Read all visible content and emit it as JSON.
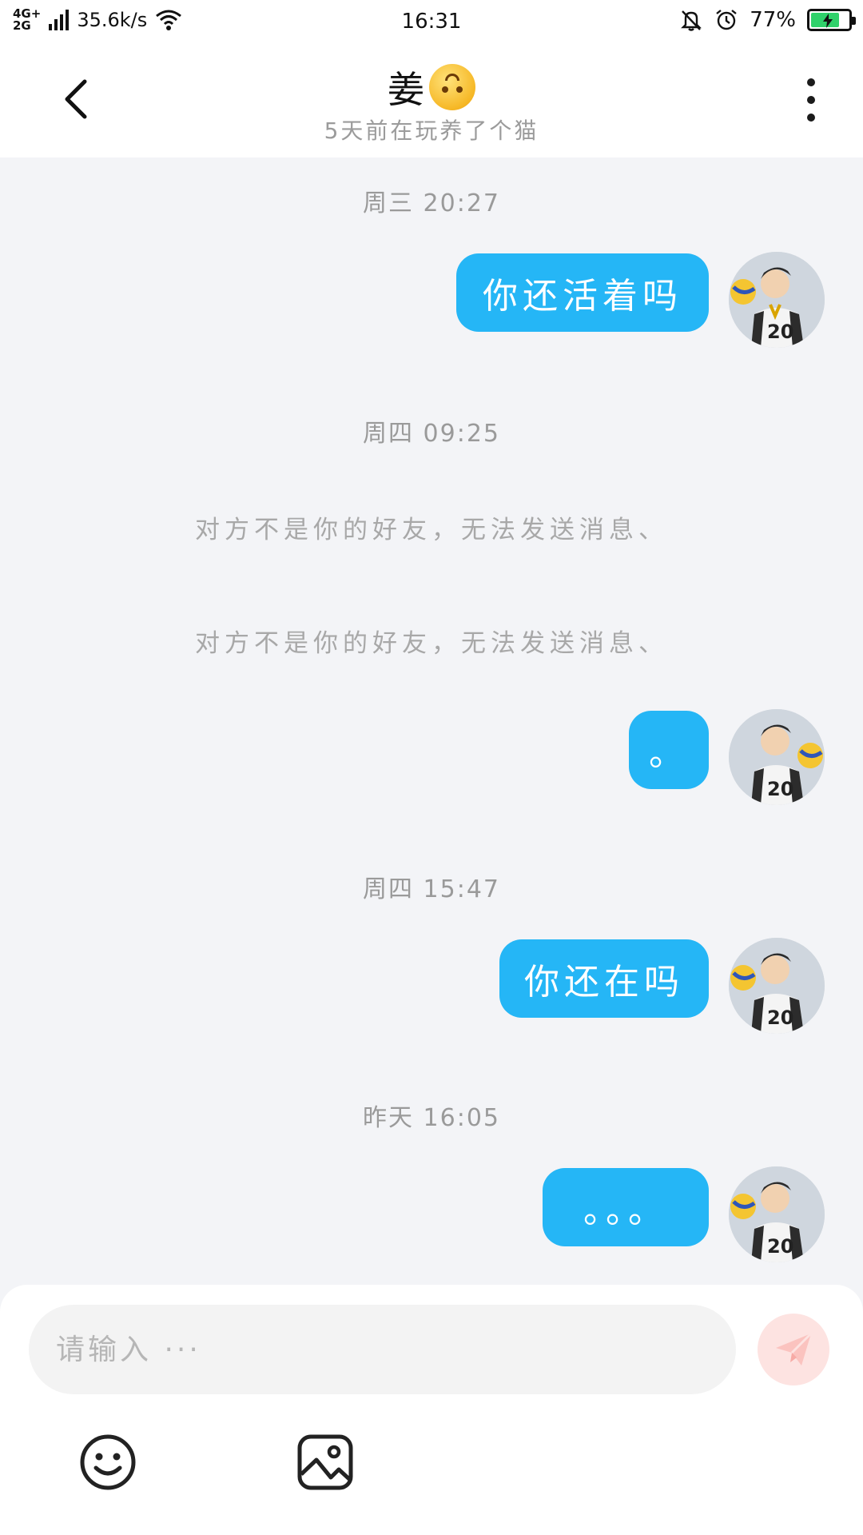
{
  "status_bar": {
    "network_type_top": "4G+",
    "network_type_bottom": "2G",
    "speed": "35.6k/s",
    "time": "16:31",
    "battery": "77%",
    "battery_level": 0.77,
    "battery_color": "#2fd16a"
  },
  "header": {
    "title": "姜",
    "subtitle": "5天前在玩养了个猫"
  },
  "conversation": [
    {
      "type": "timestamp",
      "text": "周三 20:27"
    },
    {
      "type": "sent",
      "text": "你还活着吗"
    },
    {
      "type": "timestamp",
      "text": "周四 09:25"
    },
    {
      "type": "system",
      "text": "对方不是你的好友，无法发送消息、"
    },
    {
      "type": "system",
      "text": "对方不是你的好友，无法发送消息、"
    },
    {
      "type": "sent",
      "text": "。"
    },
    {
      "type": "timestamp",
      "text": "周四 15:47"
    },
    {
      "type": "sent",
      "text": "你还在吗"
    },
    {
      "type": "timestamp",
      "text": "昨天 16:05"
    },
    {
      "type": "sent",
      "text": "。。。"
    }
  ],
  "composer": {
    "placeholder": "请输入 ···",
    "icons": [
      "send-icon",
      "emoji-icon",
      "image-icon"
    ]
  },
  "colors": {
    "bubble": "#25b6f6",
    "background": "#f3f4f7",
    "send_button": "#fde3e1"
  }
}
